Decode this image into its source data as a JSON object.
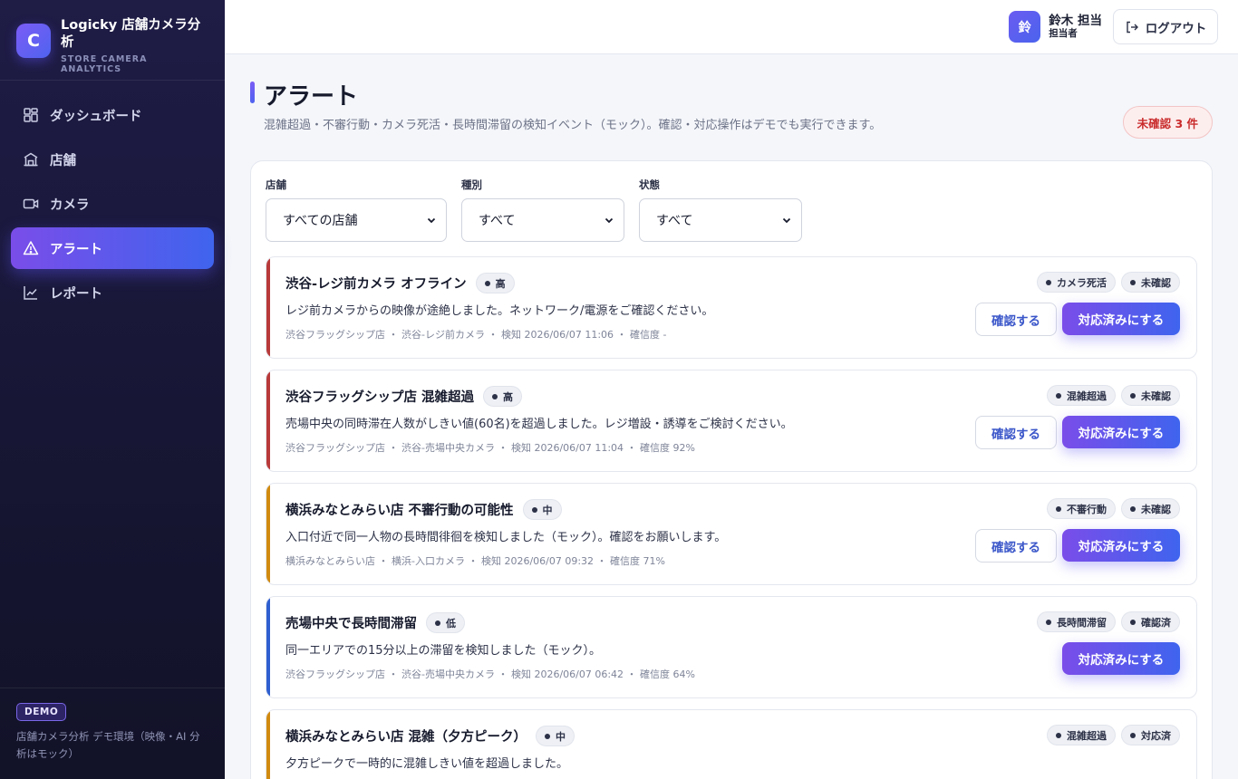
{
  "brand": {
    "logo_letter": "C",
    "name": "Logicky 店舗カメラ分析",
    "sub": "STORE CAMERA ANALYTICS"
  },
  "nav": [
    {
      "label": "ダッシュボード",
      "icon": "dashboard-icon"
    },
    {
      "label": "店舗",
      "icon": "store-icon"
    },
    {
      "label": "カメラ",
      "icon": "camera-icon"
    },
    {
      "label": "アラート",
      "icon": "alert-icon",
      "active": true
    },
    {
      "label": "レポート",
      "icon": "chart-icon"
    }
  ],
  "footer": {
    "badge": "DEMO",
    "text": "店舗カメラ分析 デモ環境（映像・AI 分析はモック）"
  },
  "header": {
    "avatar": "鈴",
    "user_name": "鈴木 担当",
    "user_role": "担当者",
    "logout_label": "ログアウト"
  },
  "page": {
    "title": "アラート",
    "description": "混雑超過・不審行動・カメラ死活・長時間滞留の検知イベント（モック）。確認・対応操作はデモでも実行できます。",
    "unconfirmed_badge": "未確認 3 件"
  },
  "filters": {
    "store": {
      "label": "店舗",
      "value": "すべての店舗"
    },
    "type": {
      "label": "種別",
      "value": "すべて"
    },
    "status": {
      "label": "状態",
      "value": "すべて"
    }
  },
  "buttons": {
    "confirm": "確認する",
    "done": "対応済みにする"
  },
  "colors": {
    "high": "#b83a3a",
    "medium": "#d18a10",
    "low": "#2f5fd0",
    "accent_start": "#7a4de9",
    "accent_end": "#3f64ee"
  },
  "alerts": [
    {
      "title": "渋谷-レジ前カメラ オフライン",
      "severity": "高",
      "description": "レジ前カメラからの映像が途絶しました。ネットワーク/電源をご確認ください。",
      "meta": "渋谷フラッグシップ店 ・ 渋谷-レジ前カメラ ・ 検知 2026/06/07 11:06 ・ 確信度 -",
      "type_tag": "カメラ死活",
      "status_tag": "未確認"
    },
    {
      "title": "渋谷フラッグシップ店 混雑超過",
      "severity": "高",
      "description": "売場中央の同時滞在人数がしきい値(60名)を超過しました。レジ増設・誘導をご検討ください。",
      "meta": "渋谷フラッグシップ店 ・ 渋谷-売場中央カメラ ・ 検知 2026/06/07 11:04 ・ 確信度 92%",
      "type_tag": "混雑超過",
      "status_tag": "未確認"
    },
    {
      "title": "横浜みなとみらい店 不審行動の可能性",
      "severity": "中",
      "description": "入口付近で同一人物の長時間徘徊を検知しました（モック）。確認をお願いします。",
      "meta": "横浜みなとみらい店 ・ 横浜-入口カメラ ・ 検知 2026/06/07 09:32 ・ 確信度 71%",
      "type_tag": "不審行動",
      "status_tag": "未確認"
    },
    {
      "title": "売場中央で長時間滞留",
      "severity": "低",
      "description": "同一エリアでの15分以上の滞留を検知しました（モック）。",
      "meta": "渋谷フラッグシップ店 ・ 渋谷-売場中央カメラ ・ 検知 2026/06/07 06:42 ・ 確信度 64%",
      "type_tag": "長時間滞留",
      "status_tag": "確認済"
    },
    {
      "title": "横浜みなとみらい店 混雑（夕方ピーク）",
      "severity": "中",
      "description": "夕方ピークで一時的に混雑しきい値を超過しました。",
      "type_tag": "混雑超過",
      "status_tag": "対応済"
    }
  ]
}
